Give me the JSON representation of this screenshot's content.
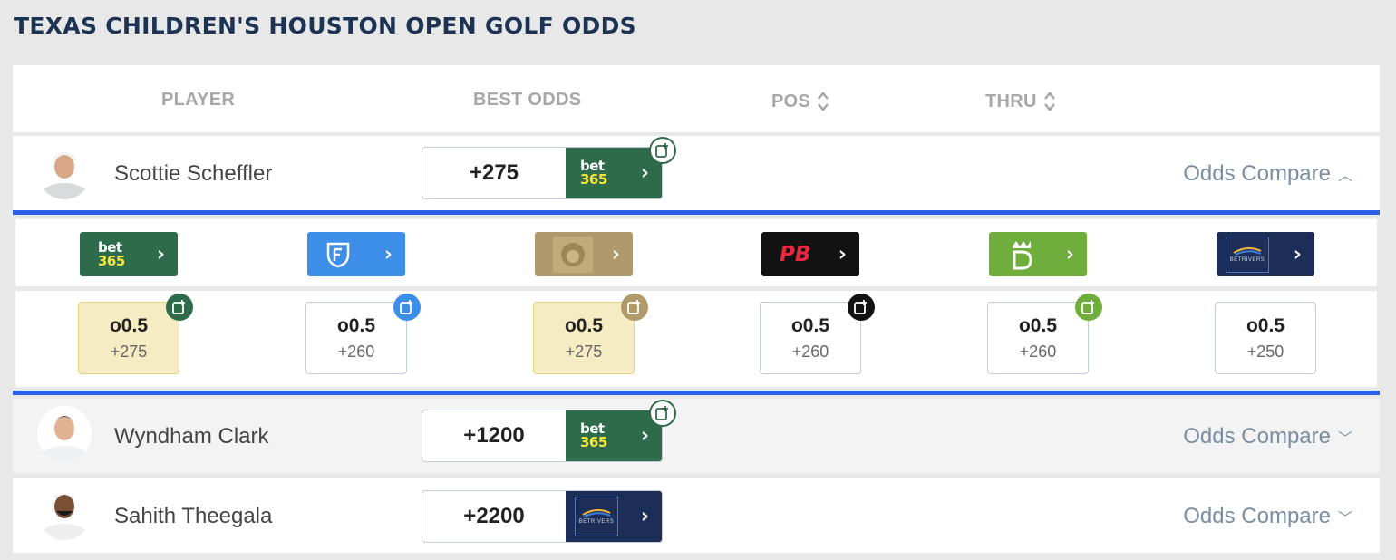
{
  "page_title": "TEXAS CHILDREN'S HOUSTON OPEN GOLF ODDS",
  "headers": {
    "player": "PLAYER",
    "best_odds": "BEST ODDS",
    "pos": "POS",
    "thru": "THRU"
  },
  "players": [
    {
      "name": "Scottie Scheffler",
      "best_odds": "+275",
      "book": "bet365",
      "odds_compare": "Odds Compare",
      "expanded": true
    },
    {
      "name": "Wyndham Clark",
      "best_odds": "+1200",
      "book": "bet365",
      "odds_compare": "Odds Compare",
      "expanded": false
    },
    {
      "name": "Sahith Theegala",
      "best_odds": "+2200",
      "book": "BetRivers",
      "odds_compare": "Odds Compare",
      "expanded": false
    }
  ],
  "sportsbooks": [
    {
      "name": "bet365",
      "color": "#2e6b4a",
      "line": "o0.5",
      "price": "+275",
      "best": true
    },
    {
      "name": "FanDuel",
      "color": "#3c8ee9",
      "line": "o0.5",
      "price": "+260",
      "best": false
    },
    {
      "name": "BetMGM",
      "color": "#b09a6c",
      "line": "o0.5",
      "price": "+275",
      "best": true
    },
    {
      "name": "PointsBet",
      "color": "#121212",
      "line": "o0.5",
      "price": "+260",
      "best": false
    },
    {
      "name": "DraftKings",
      "color": "#6fad3c",
      "line": "o0.5",
      "price": "+260",
      "best": false
    },
    {
      "name": "BetRivers",
      "color": "#1c2e57",
      "line": "o0.5",
      "price": "+250",
      "best": false
    }
  ],
  "logo_text": {
    "bet": "bet",
    "n365": "365",
    "pb": "PB",
    "betrivers": "BETRIVERS"
  },
  "colors": {
    "accent_blue": "#2c5fe8",
    "title_navy": "#1d3354",
    "best_highlight": "#f5ecc3"
  }
}
